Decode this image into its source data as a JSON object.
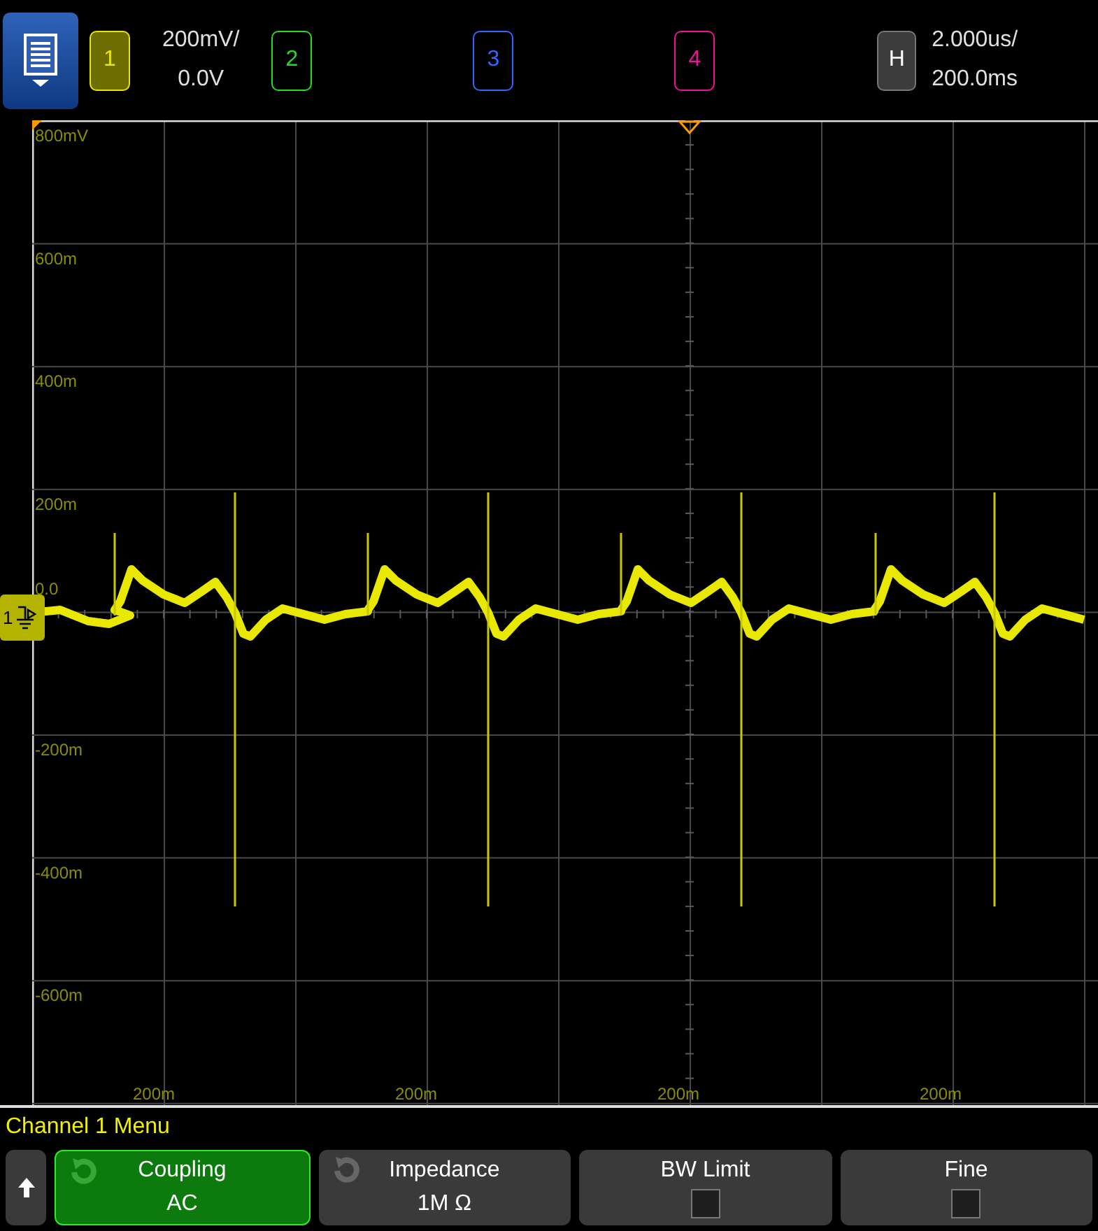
{
  "top_bar": {
    "channels": [
      {
        "label": "1",
        "color": "#e6e600",
        "selected": true
      },
      {
        "label": "2",
        "color": "#22dd22",
        "selected": false
      },
      {
        "label": "3",
        "color": "#3366ff",
        "selected": false
      },
      {
        "label": "4",
        "color": "#ee1199",
        "selected": false
      }
    ],
    "channel_scale": "200mV/",
    "channel_offset": "0.0V",
    "horizontal_label": "H",
    "time_scale": "2.000us/",
    "time_delay": "200.0ms"
  },
  "graticule": {
    "y_labels": [
      "800mV",
      "600m",
      "400m",
      "200m",
      "0.0",
      "-200m",
      "-400m",
      "-600m"
    ],
    "x_labels": [
      "200m",
      "200m",
      "200m",
      "200m"
    ],
    "ground_marker": "1"
  },
  "menu": {
    "title": "Channel 1 Menu",
    "softkeys": [
      {
        "kind": "back"
      },
      {
        "kind": "value",
        "label": "Coupling",
        "value": "AC",
        "selected": true
      },
      {
        "kind": "value",
        "label": "Impedance",
        "value": "1M Ω",
        "selected": false
      },
      {
        "kind": "checkbox",
        "label": "BW Limit",
        "checked": false
      },
      {
        "kind": "checkbox",
        "label": "Fine",
        "checked": false
      }
    ]
  }
}
